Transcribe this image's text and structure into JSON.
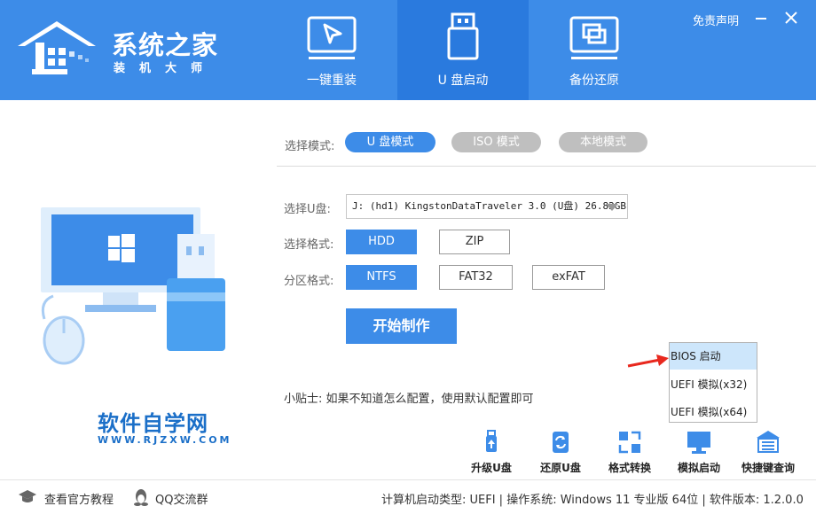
{
  "header": {
    "logo_title": "系统之家",
    "logo_sub": "装机大师",
    "tabs": [
      {
        "label": "一键重装",
        "icon": "cursor-screen-icon"
      },
      {
        "label": "U 盘启动",
        "icon": "usb-drive-icon"
      },
      {
        "label": "备份还原",
        "icon": "copy-windows-icon"
      }
    ],
    "active_tab": "U 盘启动",
    "disclaimer": "免责声明",
    "colors": {
      "header_bg": "#3d8ce8",
      "active_tab_bg": "#2a7ade"
    }
  },
  "mode": {
    "label": "选择模式:",
    "options": [
      "U 盘模式",
      "ISO 模式",
      "本地模式"
    ],
    "selected": "U 盘模式"
  },
  "usb": {
    "label": "选择U盘:",
    "value": "J: (hd1) KingstonDataTraveler 3.0 (U盘) 26.82GB"
  },
  "format": {
    "label": "选择格式:",
    "options": [
      "HDD",
      "ZIP"
    ],
    "selected": "HDD"
  },
  "partition": {
    "label": "分区格式:",
    "options": [
      "NTFS",
      "FAT32",
      "exFAT"
    ],
    "selected": "NTFS"
  },
  "start_button": "开始制作",
  "tip": "小贴士: 如果不知道怎么配置，使用默认配置即可",
  "boot_menu": {
    "items": [
      "BIOS 启动",
      "UEFI 模拟(x32)",
      "UEFI 模拟(x64)"
    ],
    "selected": "BIOS 启动"
  },
  "brand": {
    "name": "软件自学网",
    "url": "WWW.RJZXW.COM"
  },
  "tools": [
    {
      "label": "升级U盘",
      "icon": "usb-upgrade-icon"
    },
    {
      "label": "还原U盘",
      "icon": "restore-icon"
    },
    {
      "label": "格式转换",
      "icon": "convert-icon"
    },
    {
      "label": "模拟启动",
      "icon": "monitor-icon"
    },
    {
      "label": "快捷键查询",
      "icon": "keyboard-icon"
    }
  ],
  "footer": {
    "tutorial": "查看官方教程",
    "qq_group": "QQ交流群",
    "status": "计算机启动类型: UEFI | 操作系统: Windows 11 专业版 64位 | 软件版本: 1.2.0.0"
  }
}
